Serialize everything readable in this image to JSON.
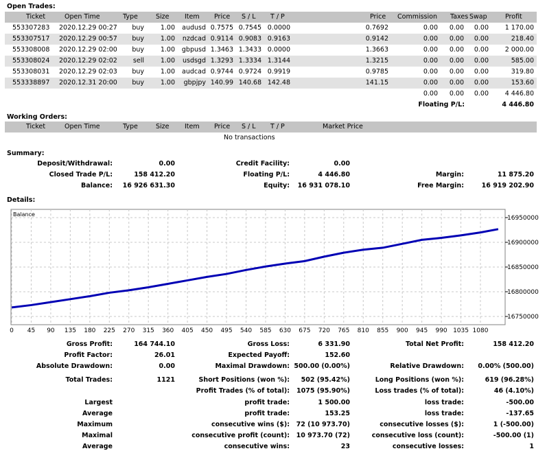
{
  "open_trades": {
    "title": "Open Trades:",
    "headers": [
      "Ticket",
      "Open Time",
      "Type",
      "Size",
      "Item",
      "Price",
      "S / L",
      "T / P",
      "Price",
      "Commission",
      "Taxes",
      "Swap",
      "Profit"
    ],
    "rows": [
      [
        "553307283",
        "2020.12.29 00:27",
        "buy",
        "1.00",
        "audusd",
        "0.7575",
        "0.7545",
        "0.0000",
        "0.7692",
        "0.00",
        "0.00",
        "0.00",
        "1 170.00"
      ],
      [
        "553307517",
        "2020.12.29 00:57",
        "buy",
        "1.00",
        "nzdcad",
        "0.9114",
        "0.9083",
        "0.9163",
        "0.9142",
        "0.00",
        "0.00",
        "0.00",
        "218.40"
      ],
      [
        "553308008",
        "2020.12.29 02:00",
        "buy",
        "1.00",
        "gbpusd",
        "1.3463",
        "1.3433",
        "0.0000",
        "1.3663",
        "0.00",
        "0.00",
        "0.00",
        "2 000.00"
      ],
      [
        "553308024",
        "2020.12.29 02:02",
        "sell",
        "1.00",
        "usdsgd",
        "1.3293",
        "1.3334",
        "1.3144",
        "1.3215",
        "0.00",
        "0.00",
        "0.00",
        "585.00"
      ],
      [
        "553308031",
        "2020.12.29 02:03",
        "buy",
        "1.00",
        "audcad",
        "0.9744",
        "0.9724",
        "0.9919",
        "0.9785",
        "0.00",
        "0.00",
        "0.00",
        "319.80"
      ],
      [
        "553338897",
        "2020.12.31 20:00",
        "buy",
        "1.00",
        "gbpjpy",
        "140.99",
        "140.68",
        "142.48",
        "141.15",
        "0.00",
        "0.00",
        "0.00",
        "153.60"
      ]
    ],
    "totals": {
      "commission": "0.00",
      "taxes": "0.00",
      "swap": "0.00",
      "profit": "4 446.80"
    },
    "floating_label": "Floating P/L:",
    "floating_value": "4 446.80"
  },
  "working_orders": {
    "title": "Working Orders:",
    "headers": [
      "Ticket",
      "Open Time",
      "Type",
      "Size",
      "Item",
      "Price",
      "S / L",
      "T / P",
      "Market Price"
    ],
    "empty": "No transactions"
  },
  "summary": {
    "title": "Summary:",
    "rows": [
      [
        [
          "Deposit/Withdrawal:",
          "0.00"
        ],
        [
          "Credit Facility:",
          "0.00"
        ],
        [
          "",
          ""
        ]
      ],
      [
        [
          "Closed Trade P/L:",
          "158 412.20"
        ],
        [
          "Floating P/L:",
          "4 446.80"
        ],
        [
          "Margin:",
          "11 875.20"
        ]
      ],
      [
        [
          "Balance:",
          "16 926 631.30"
        ],
        [
          "Equity:",
          "16 931 078.10"
        ],
        [
          "Free Margin:",
          "16 919 202.90"
        ]
      ]
    ]
  },
  "details": {
    "title": "Details:",
    "stats": [
      [
        [
          "Gross Profit:",
          "164 744.10"
        ],
        [
          "Gross Loss:",
          "6 331.90"
        ],
        [
          "Total Net Profit:",
          "158 412.20"
        ]
      ],
      [
        [
          "Profit Factor:",
          "26.01"
        ],
        [
          "Expected Payoff:",
          "152.60"
        ],
        [
          "",
          ""
        ]
      ],
      [
        [
          "Absolute Drawdown:",
          "0.00"
        ],
        [
          "Maximal Drawdown:",
          "500.00 (0.00%)"
        ],
        [
          "Relative Drawdown:",
          "0.00% (500.00)"
        ]
      ],
      [
        [
          "Total Trades:",
          "1121"
        ],
        [
          "Short Positions (won %):",
          "502 (95.42%)"
        ],
        [
          "Long Positions (won %):",
          "619 (96.28%)"
        ]
      ],
      [
        [
          "",
          ""
        ],
        [
          "Profit Trades (% of total):",
          "1075 (95.90%)"
        ],
        [
          "Loss trades (% of total):",
          "46 (4.10%)"
        ]
      ],
      [
        [
          "Largest",
          ""
        ],
        [
          "profit trade:",
          "1 500.00"
        ],
        [
          "loss trade:",
          "-500.00"
        ]
      ],
      [
        [
          "Average",
          ""
        ],
        [
          "profit trade:",
          "153.25"
        ],
        [
          "loss trade:",
          "-137.65"
        ]
      ],
      [
        [
          "Maximum",
          ""
        ],
        [
          "consecutive wins ($):",
          "72 (10 973.70)"
        ],
        [
          "consecutive losses ($):",
          "1 (-500.00)"
        ]
      ],
      [
        [
          "Maximal",
          ""
        ],
        [
          "consecutive profit (count):",
          "10 973.70 (72)"
        ],
        [
          "consecutive loss (count):",
          "-500.00 (1)"
        ]
      ],
      [
        [
          "Average",
          ""
        ],
        [
          "consecutive wins:",
          "23"
        ],
        [
          "consecutive losses:",
          "1"
        ]
      ]
    ]
  },
  "chart_data": {
    "type": "line",
    "legend": "Balance",
    "line_color": "#0000b4",
    "grid": true,
    "xlim": [
      0,
      1121
    ],
    "ylim": [
      16735000,
      16965000
    ],
    "x_ticks": [
      0,
      45,
      90,
      135,
      180,
      225,
      270,
      315,
      360,
      405,
      450,
      495,
      540,
      585,
      630,
      675,
      720,
      765,
      810,
      855,
      900,
      945,
      990,
      1035,
      1080
    ],
    "y_ticks": [
      16750000,
      16800000,
      16850000,
      16900000,
      16950000
    ],
    "x": [
      0,
      45,
      90,
      135,
      180,
      225,
      270,
      315,
      360,
      405,
      450,
      495,
      540,
      585,
      630,
      675,
      720,
      765,
      810,
      855,
      900,
      945,
      990,
      1035,
      1080,
      1121
    ],
    "y": [
      16768219,
      16773000,
      16779000,
      16785000,
      16791000,
      16798000,
      16803000,
      16809000,
      16816000,
      16823000,
      16830000,
      16836000,
      16844000,
      16851000,
      16857000,
      16862000,
      16871000,
      16879000,
      16885000,
      16889000,
      16897000,
      16905000,
      16909000,
      16914000,
      16920000,
      16926631
    ]
  }
}
